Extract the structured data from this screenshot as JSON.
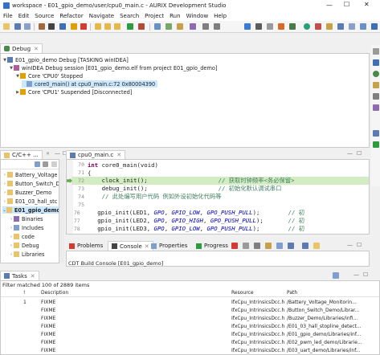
{
  "window": {
    "title": "workspace - E01_gpio_demo/user/cpu0_main.c - AURIX Development Studio"
  },
  "menu": [
    "File",
    "Edit",
    "Source",
    "Refactor",
    "Navigate",
    "Search",
    "Project",
    "Run",
    "Window",
    "Help"
  ],
  "debug": {
    "tab_label": "Debug",
    "tree": [
      "E01_gpio_demo Debug [TASKING winIDEA]",
      "winIDEA Debug session [E01_gpio_demo.elf from project E01_gpio_demo]",
      "Core 'CPU0' Stopped",
      "core0_main() at cpu0_main.c:72 0x80004390",
      "Core 'CPU1' Suspended [Disconnected]"
    ]
  },
  "project": {
    "tab_label": "C/C++ ...",
    "items": [
      "Battery_Voltage",
      "Button_Switch_D",
      "Buzzer_Demo",
      "E01_03_hall_stc",
      "E01_gpio_demo",
      "Binaries",
      "Includes",
      "code",
      "Debug",
      "Libraries"
    ]
  },
  "editor": {
    "tab_label": "cpu0_main.c",
    "lines": [
      {
        "num": "70",
        "parts": [
          {
            "t": "int ",
            "c": "kw"
          },
          {
            "t": "core0_main(void)",
            "c": ""
          }
        ]
      },
      {
        "num": "71",
        "parts": [
          {
            "t": "{",
            "c": ""
          }
        ]
      },
      {
        "num": "72",
        "parts": [
          {
            "t": "    clock_init();                    ",
            "c": ""
          },
          {
            "t": "// 获取时钟频率<务必保留>",
            "c": "cm"
          }
        ]
      },
      {
        "num": "73",
        "parts": [
          {
            "t": "    debug_init();                    ",
            "c": ""
          },
          {
            "t": "// 初始化默认调试串口",
            "c": "cm"
          }
        ]
      },
      {
        "num": "74",
        "parts": [
          {
            "t": "    ",
            "c": ""
          },
          {
            "t": "// 此处编写用户代码 例如外设初始化代码等",
            "c": "cm"
          }
        ]
      },
      {
        "num": "75",
        "parts": [
          {
            "t": "",
            "c": ""
          }
        ]
      },
      {
        "num": "76",
        "parts": [
          {
            "t": "    gpio_init(LED1, ",
            "c": ""
          },
          {
            "t": "GPO",
            "c": "cst"
          },
          {
            "t": ", ",
            "c": ""
          },
          {
            "t": "GPIO_LOW",
            "c": "cst"
          },
          {
            "t": ", ",
            "c": ""
          },
          {
            "t": "GPO_PUSH_PULL",
            "c": "cst"
          },
          {
            "t": ");        ",
            "c": ""
          },
          {
            "t": "// 初",
            "c": "cm"
          }
        ]
      },
      {
        "num": "77",
        "parts": [
          {
            "t": "    gpio_init(LED2, ",
            "c": ""
          },
          {
            "t": "GPO",
            "c": "cst"
          },
          {
            "t": ", ",
            "c": ""
          },
          {
            "t": "GPIO_HIGH",
            "c": "cst"
          },
          {
            "t": ", ",
            "c": ""
          },
          {
            "t": "GPO_PUSH_PULL",
            "c": "cst"
          },
          {
            "t": ");       ",
            "c": ""
          },
          {
            "t": "// 初",
            "c": "cm"
          }
        ]
      },
      {
        "num": "78",
        "parts": [
          {
            "t": "    gpio_init(LED3, ",
            "c": ""
          },
          {
            "t": "GPO",
            "c": "cst"
          },
          {
            "t": ", ",
            "c": ""
          },
          {
            "t": "GPIO_LOW",
            "c": "cst"
          },
          {
            "t": ", ",
            "c": ""
          },
          {
            "t": "GPO_PUSH_PULL",
            "c": "cst"
          },
          {
            "t": ");        ",
            "c": ""
          },
          {
            "t": "// 初",
            "c": "cm"
          }
        ]
      }
    ]
  },
  "bottom_tabs": [
    "Problems",
    "Console",
    "Properties",
    "Progress"
  ],
  "console": {
    "text": "CDT Build Console [E01_gpio_demo]"
  },
  "tasks": {
    "tab_label": "Tasks",
    "filter_text": "Filter matched 100 of 2889 items",
    "columns": [
      "!",
      "Description",
      "Resource",
      "Path"
    ],
    "rows": [
      {
        "mark": "1",
        "description": "FIXME",
        "resource": "IfxCpu_IntrinsicsDcc.h",
        "path": "/Battery_Voltage_Monitorin..."
      },
      {
        "mark": "",
        "description": "FIXME",
        "resource": "IfxCpu_IntrinsicsDcc.h",
        "path": "/Button_Switch_Demo/Librar..."
      },
      {
        "mark": "",
        "description": "FIXME",
        "resource": "IfxCpu_IntrinsicsDcc.h",
        "path": "/Buzzer_Demo/Libraries/infi..."
      },
      {
        "mark": "",
        "description": "FIXME",
        "resource": "IfxCpu_IntrinsicsDcc.h",
        "path": "/E01_03_hall_stopline_detect..."
      },
      {
        "mark": "",
        "description": "FIXME",
        "resource": "IfxCpu_IntrinsicsDcc.h",
        "path": "/E01_gpio_demo/Libraries/inf..."
      },
      {
        "mark": "",
        "description": "FIXME",
        "resource": "IfxCpu_IntrinsicsDcc.h",
        "path": "/E02_pwm_led_demo/Librarie..."
      },
      {
        "mark": "",
        "description": "FIXME",
        "resource": "IfxCpu_IntrinsicsDcc.h",
        "path": "/E03_uart_demo/Libraries/inf..."
      }
    ]
  },
  "colors": {
    "accent": "#3874d8",
    "selection": "#cce8ff",
    "current_line": "#d4ecc3",
    "green_mark": "#6aa84f"
  }
}
